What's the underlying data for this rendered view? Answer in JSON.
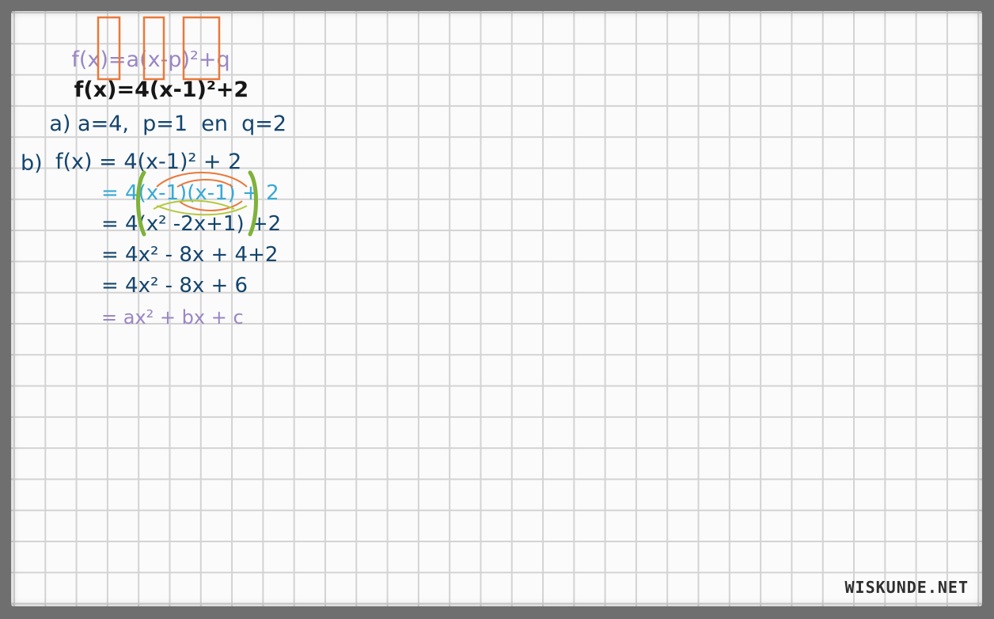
{
  "general_form": {
    "label": "f(x)=",
    "a": "a",
    "mid": "(x-",
    "p": "p",
    "close": ")²",
    "q": "+q"
  },
  "specific_form": {
    "label": "f(x)=",
    "a": "4",
    "mid": "(x-",
    "p": "1",
    "close": ")²",
    "q": "+2"
  },
  "part_a": {
    "label": "a)",
    "text": "a=4,  p=1  en  q=2"
  },
  "part_b": {
    "label": "b)",
    "line1": "f(x) = 4(x-1)² + 2",
    "line2": "= 4(x-1)(x-1) + 2",
    "line3": "= 4(x² -2x+1) +2",
    "line4": "= 4x² - 8x + 4+2",
    "line5": "= 4x² - 8x + 6",
    "line6": "= ax² + bx + c"
  },
  "colors": {
    "purple": "#9a86c4",
    "black": "#171717",
    "navy": "#14456e",
    "cyan": "#36a9d6",
    "orange_box": "#e9793b",
    "green_bracket": "#7fb23a"
  },
  "watermark": "WISKUNDE.NET"
}
